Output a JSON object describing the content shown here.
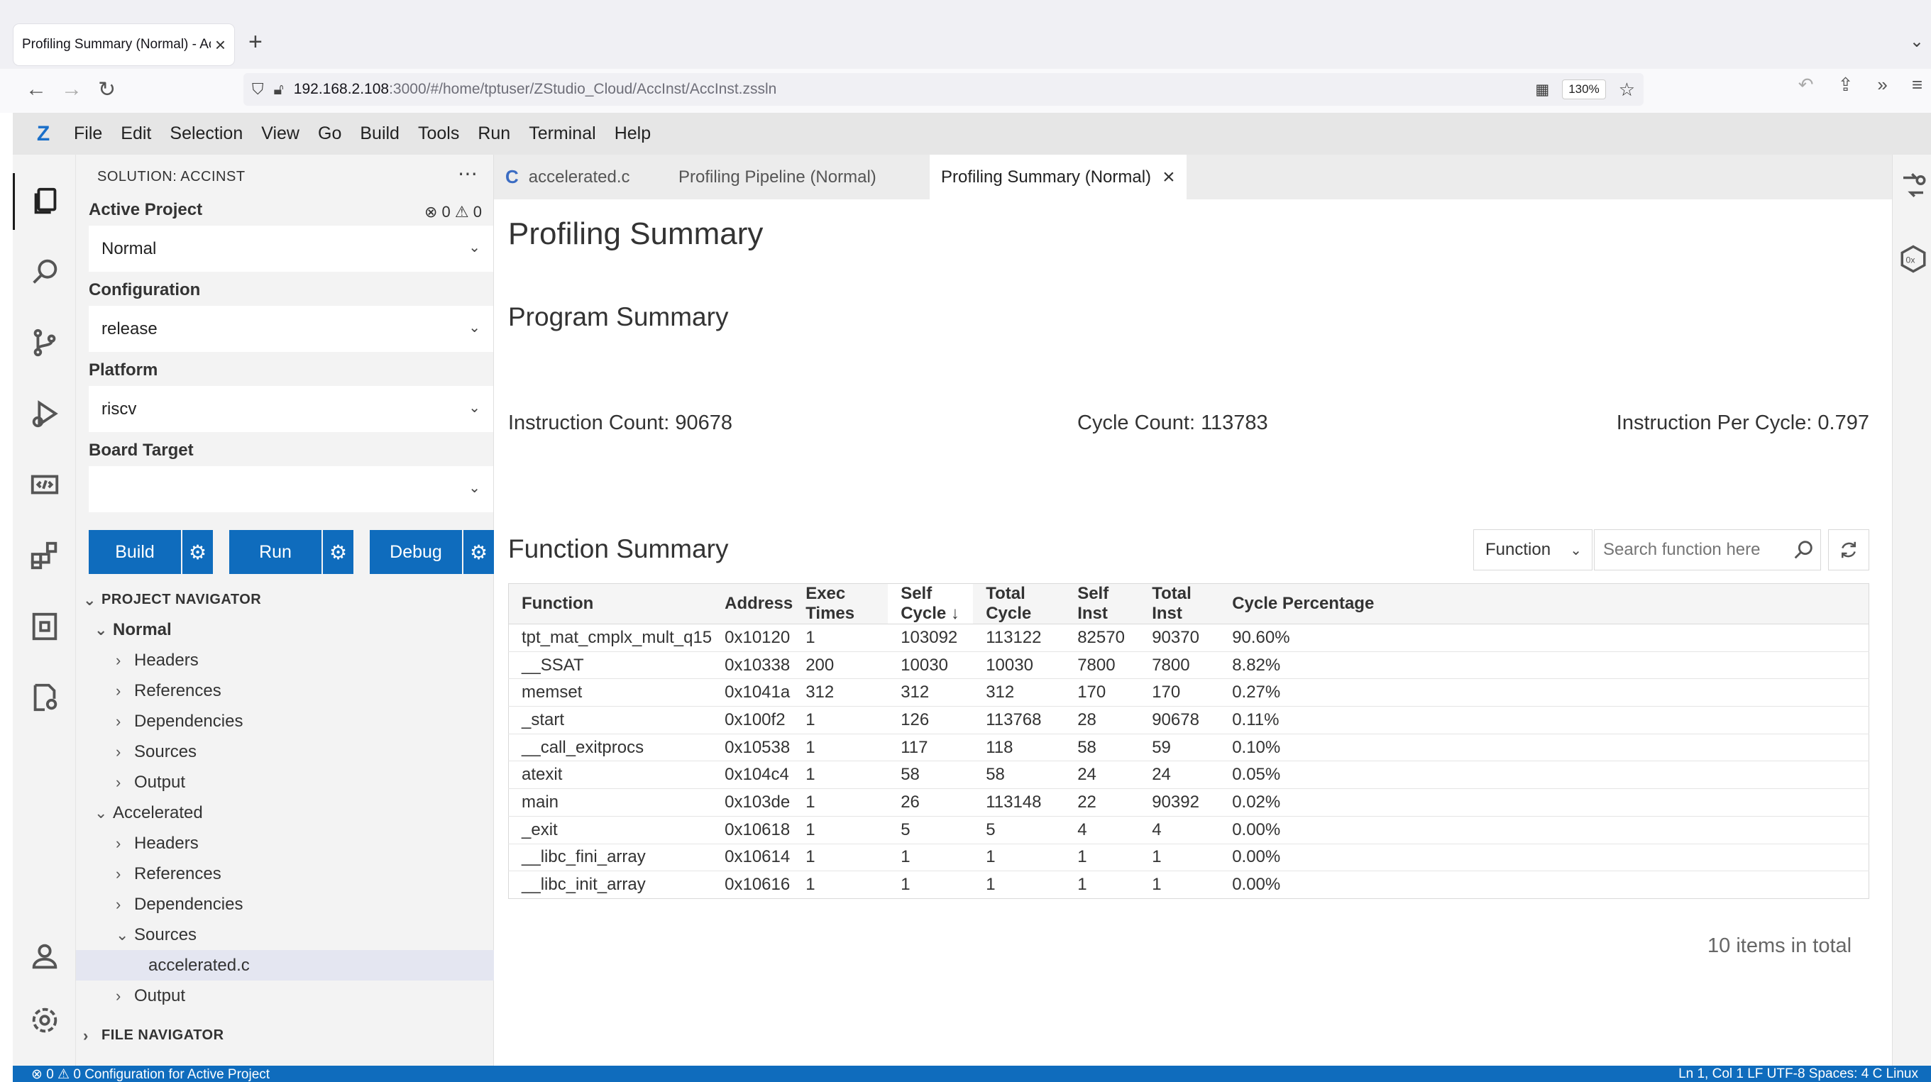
{
  "browser": {
    "tab_title": "Profiling Summary (Normal) - Ac",
    "url_host": "192.168.2.108",
    "url_path": ":3000/#/home/tptuser/ZStudio_Cloud/AccInst/AccInst.zssln",
    "zoom": "130%"
  },
  "menubar": {
    "logo": "Z",
    "items": [
      "File",
      "Edit",
      "Selection",
      "View",
      "Go",
      "Build",
      "Tools",
      "Run",
      "Terminal",
      "Help"
    ]
  },
  "sidebar": {
    "header": "SOLUTION: ACCINST",
    "active_project_label": "Active Project",
    "error_count": "0",
    "warning_count": "0",
    "active_project_value": "Normal",
    "configuration_label": "Configuration",
    "configuration_value": "release",
    "platform_label": "Platform",
    "platform_value": "riscv",
    "board_target_label": "Board Target",
    "board_target_value": "",
    "build_label": "Build",
    "run_label": "Run",
    "debug_label": "Debug",
    "project_navigator": "PROJECT NAVIGATOR",
    "tree": [
      {
        "label": "Normal",
        "level": 1,
        "expanded": true
      },
      {
        "label": "Headers",
        "level": 2,
        "expanded": false
      },
      {
        "label": "References",
        "level": 2,
        "expanded": false
      },
      {
        "label": "Dependencies",
        "level": 2,
        "expanded": false
      },
      {
        "label": "Sources",
        "level": 2,
        "expanded": false
      },
      {
        "label": "Output",
        "level": 2,
        "expanded": false
      },
      {
        "label": "Accelerated",
        "level": 1,
        "expanded": true
      },
      {
        "label": "Headers",
        "level": 2,
        "expanded": false
      },
      {
        "label": "References",
        "level": 2,
        "expanded": false
      },
      {
        "label": "Dependencies",
        "level": 2,
        "expanded": false
      },
      {
        "label": "Sources",
        "level": 2,
        "expanded": true
      },
      {
        "label": "accelerated.c",
        "level": 3,
        "selected": true
      },
      {
        "label": "Output",
        "level": 2,
        "expanded": false
      }
    ],
    "file_navigator": "FILE NAVIGATOR"
  },
  "status": {
    "left": "⊗ 0  ⚠ 0    Configuration for Active Project",
    "right": "Ln 1, Col 1   LF   UTF-8   Spaces: 4   C   Linux"
  },
  "editor_tabs": [
    {
      "label": "accelerated.c",
      "icon": "C"
    },
    {
      "label": "Profiling Pipeline (Normal)"
    },
    {
      "label": "Profiling Summary (Normal)",
      "active": true
    }
  ],
  "content": {
    "title": "Profiling Summary",
    "program_summary": "Program Summary",
    "instruction_count": "Instruction Count: 90678",
    "cycle_count": "Cycle Count: 113783",
    "ipc": "Instruction Per Cycle: 0.797",
    "function_summary": "Function Summary",
    "filter_value": "Function",
    "search_placeholder": "Search function here",
    "columns": [
      "Function",
      "Address",
      "Exec Times",
      "Self Cycle",
      "Total Cycle",
      "Self Inst",
      "Total Inst",
      "Cycle Percentage"
    ],
    "sort_indicator": "↓",
    "rows": [
      [
        "tpt_mat_cmplx_mult_q15",
        "0x10120",
        "1",
        "103092",
        "113122",
        "82570",
        "90370",
        "90.60%"
      ],
      [
        "__SSAT",
        "0x10338",
        "200",
        "10030",
        "10030",
        "7800",
        "7800",
        "8.82%"
      ],
      [
        "memset",
        "0x1041a",
        "312",
        "312",
        "312",
        "170",
        "170",
        "0.27%"
      ],
      [
        "_start",
        "0x100f2",
        "1",
        "126",
        "113768",
        "28",
        "90678",
        "0.11%"
      ],
      [
        "__call_exitprocs",
        "0x10538",
        "1",
        "117",
        "118",
        "58",
        "59",
        "0.10%"
      ],
      [
        "atexit",
        "0x104c4",
        "1",
        "58",
        "58",
        "24",
        "24",
        "0.05%"
      ],
      [
        "main",
        "0x103de",
        "1",
        "26",
        "113148",
        "22",
        "90392",
        "0.02%"
      ],
      [
        "_exit",
        "0x10618",
        "1",
        "5",
        "5",
        "4",
        "4",
        "0.00%"
      ],
      [
        "__libc_fini_array",
        "0x10614",
        "1",
        "1",
        "1",
        "1",
        "1",
        "0.00%"
      ],
      [
        "__libc_init_array",
        "0x10616",
        "1",
        "1",
        "1",
        "1",
        "1",
        "0.00%"
      ]
    ],
    "total_text": "10 items in total"
  }
}
